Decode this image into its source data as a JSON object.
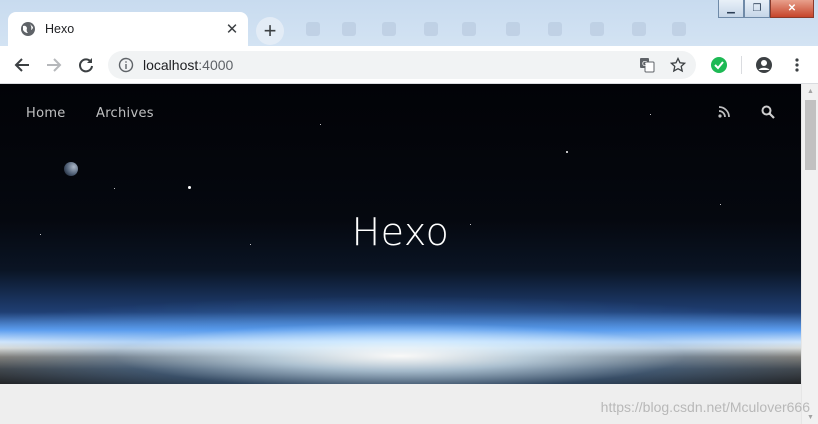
{
  "browser": {
    "tab": {
      "title": "Hexo",
      "favicon": "globe-icon"
    },
    "window_controls": [
      "minimize-icon",
      "maximize-icon",
      "close-icon"
    ],
    "address_bar": {
      "host": "localhost",
      "port": ":4000"
    },
    "toolbar_icons": [
      "back-arrow-icon",
      "forward-arrow-icon",
      "reload-icon",
      "info-icon",
      "translate-icon",
      "star-icon",
      "extension-icon",
      "account-icon",
      "menu-kebab-icon"
    ]
  },
  "site": {
    "nav": {
      "home": "Home",
      "archives": "Archives"
    },
    "nav_icons": [
      "rss-icon",
      "search-icon"
    ],
    "hero_title": "Hexo"
  },
  "watermark": "https://blog.csdn.net/Mculover666",
  "colors": {
    "accent_extension": "#1db954",
    "tab_strip": "#cfe0f2",
    "page_bg": "#eeeeee"
  }
}
